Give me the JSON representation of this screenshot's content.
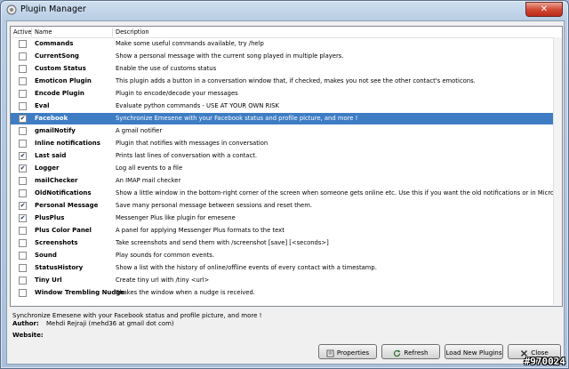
{
  "window": {
    "title": "Plugin Manager",
    "close_glyph": "✕"
  },
  "table": {
    "headers": {
      "active": "Active",
      "name": "Name",
      "description": "Description"
    },
    "rows": [
      {
        "active": false,
        "name": "Commands",
        "description": "Make some useful commands available, try /help"
      },
      {
        "active": false,
        "name": "CurrentSong",
        "description": "Show a personal message with the current song played in multiple players."
      },
      {
        "active": false,
        "name": "Custom Status",
        "description": "Enable the use of customs status"
      },
      {
        "active": false,
        "name": "Emoticon Plugin",
        "description": "This plugin adds a button in a conversation window that, if checked, makes you not see the other contact's emoticons."
      },
      {
        "active": false,
        "name": "Encode Plugin",
        "description": "Plugin to encode/decode your messages"
      },
      {
        "active": false,
        "name": "Eval",
        "description": "Evaluate python commands - USE AT YOUR OWN RISK"
      },
      {
        "active": true,
        "name": "Facebook",
        "description": "Synchronize Emesene with your Facebook status and profile picture, and more !",
        "selected": true
      },
      {
        "active": false,
        "name": "gmailNotify",
        "description": "A gmail notifier"
      },
      {
        "active": false,
        "name": "Inline notifications",
        "description": "Plugin that notifies with messages in conversation"
      },
      {
        "active": true,
        "name": "Last said",
        "description": "Prints last lines of conversation with a contact."
      },
      {
        "active": true,
        "name": "Logger",
        "description": "Log all events to a file"
      },
      {
        "active": false,
        "name": "mailChecker",
        "description": "An IMAP mail checker"
      },
      {
        "active": false,
        "name": "OldNotifications",
        "description": "Show a little window in the bottom-right corner of the screen when someone gets online etc. Use this if you want the old notifications or in Microsoft Windows"
      },
      {
        "active": true,
        "name": "Personal Message",
        "description": "Save many personal message between sessions and reset them."
      },
      {
        "active": true,
        "name": "PlusPlus",
        "description": "Messenger Plus like plugin for emesene"
      },
      {
        "active": false,
        "name": "Plus Color Panel",
        "description": "A panel for applying Messenger Plus formats to the text"
      },
      {
        "active": false,
        "name": "Screenshots",
        "description": "Take screenshots and send them with              /screenshot [save] [<seconds>]"
      },
      {
        "active": false,
        "name": "Sound",
        "description": "Play sounds for common events."
      },
      {
        "active": false,
        "name": "StatusHistory",
        "description": "Show a list with the history of online/offline events of every contact with a timestamp."
      },
      {
        "active": false,
        "name": "Tiny Url",
        "description": "Create tiny url with /tiny <url>"
      },
      {
        "active": false,
        "name": "Window Trembling Nudge",
        "description": "Shakes the window when a nudge is received."
      }
    ]
  },
  "details": {
    "summary": "Synchronize Emesene with your Facebook status and profile picture, and more !",
    "author_label": "Author:",
    "author_value": "Mehdi Rejraji (mehd36 at gmail dot com)",
    "website_label": "Website:"
  },
  "buttons": {
    "properties": "Properties",
    "refresh": "Refresh",
    "load_new": "Load New Plugins",
    "close": "Close"
  },
  "watermark": "#970024",
  "colors": {
    "selection": "#3e7dc4",
    "title_close": "#d24b36"
  }
}
